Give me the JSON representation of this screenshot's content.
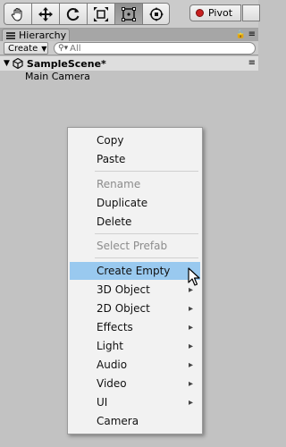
{
  "toolbar": {
    "tools": [
      "hand-tool",
      "move-tool",
      "rotate-tool",
      "scale-tool",
      "rect-tool",
      "transform-tool"
    ],
    "active_tool_index": 4,
    "pivot_label": "Pivot"
  },
  "hierarchy": {
    "tab_label": "Hierarchy",
    "create_label": "Create",
    "search_placeholder": "All",
    "scene_name": "SampleScene*",
    "objects": [
      "Main Camera"
    ]
  },
  "context_menu": {
    "items": [
      {
        "label": "Copy",
        "enabled": true
      },
      {
        "label": "Paste",
        "enabled": true
      },
      {
        "label": "Rename",
        "enabled": false
      },
      {
        "label": "Duplicate",
        "enabled": true
      },
      {
        "label": "Delete",
        "enabled": true
      },
      {
        "label": "Select Prefab",
        "enabled": false
      },
      {
        "label": "Create Empty",
        "enabled": true,
        "highlighted": true
      },
      {
        "label": "3D Object",
        "enabled": true,
        "submenu": true
      },
      {
        "label": "2D Object",
        "enabled": true,
        "submenu": true
      },
      {
        "label": "Effects",
        "enabled": true,
        "submenu": true
      },
      {
        "label": "Light",
        "enabled": true,
        "submenu": true
      },
      {
        "label": "Audio",
        "enabled": true,
        "submenu": true
      },
      {
        "label": "Video",
        "enabled": true,
        "submenu": true
      },
      {
        "label": "UI",
        "enabled": true,
        "submenu": true
      },
      {
        "label": "Camera",
        "enabled": true
      }
    ]
  },
  "colors": {
    "highlight": "#99c9ef",
    "background": "#c2c2c2",
    "menu_background": "#f2f2f2"
  }
}
